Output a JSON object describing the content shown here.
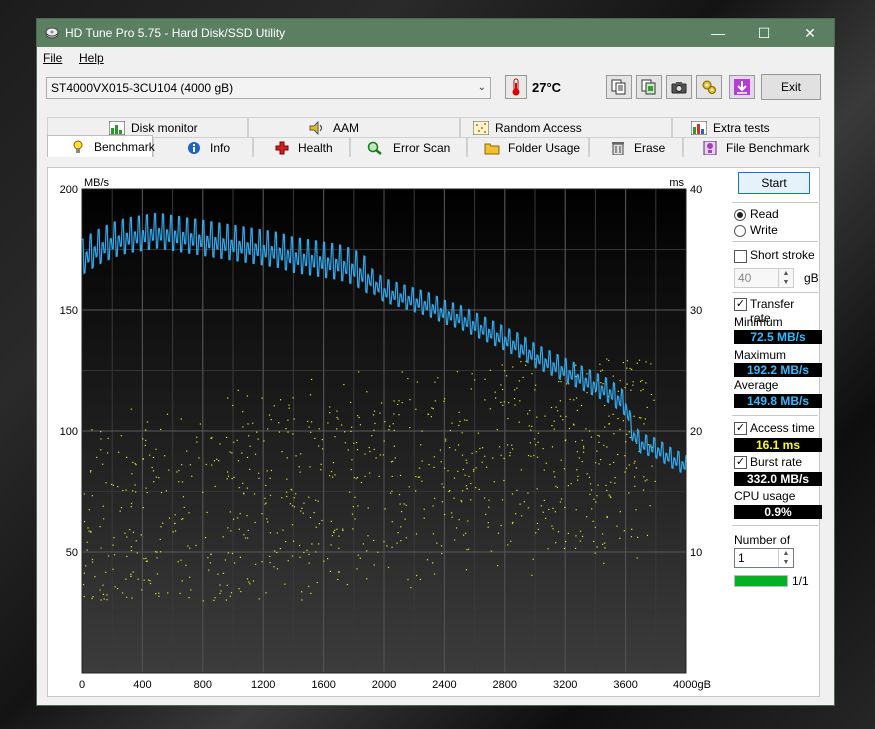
{
  "window": {
    "title": "HD Tune Pro 5.75 - Hard Disk/SSD Utility",
    "controls": {
      "minimize": "—",
      "maximize": "☐",
      "close": "✕"
    }
  },
  "menu": {
    "file": "File",
    "help": "Help"
  },
  "toolbar": {
    "drive": "ST4000VX015-3CU104 (4000 gB)",
    "temperature": "27°C",
    "exit_label": "Exit",
    "icons": [
      "copy-text-icon",
      "copy-screenshot-icon",
      "camera-icon",
      "options-icon",
      "save-down-icon"
    ]
  },
  "tabs_top": [
    {
      "label": "Disk monitor",
      "icon": "disk-monitor-icon"
    },
    {
      "label": "AAM",
      "icon": "speaker-icon"
    },
    {
      "label": "Random Access",
      "icon": "random-access-icon"
    },
    {
      "label": "Extra tests",
      "icon": "extra-tests-icon"
    }
  ],
  "tabs_bottom": [
    {
      "label": "Benchmark",
      "icon": "lightbulb-icon",
      "active": true
    },
    {
      "label": "Info",
      "icon": "info-icon"
    },
    {
      "label": "Health",
      "icon": "health-cross-icon"
    },
    {
      "label": "Error Scan",
      "icon": "magnifier-icon"
    },
    {
      "label": "Folder Usage",
      "icon": "folder-icon"
    },
    {
      "label": "Erase",
      "icon": "trash-icon"
    },
    {
      "label": "File Benchmark",
      "icon": "file-benchmark-icon"
    }
  ],
  "side": {
    "start_label": "Start",
    "read_label": "Read",
    "write_label": "Write",
    "mode_selected": "Read",
    "short_stroke_label": "Short stroke",
    "short_stroke_checked": false,
    "short_stroke_value": "40",
    "short_stroke_unit": "gB",
    "transfer_rate_label": "Transfer rate",
    "transfer_rate_checked": true,
    "minimum_label": "Minimum",
    "minimum_value": "72.5 MB/s",
    "maximum_label": "Maximum",
    "maximum_value": "192.2 MB/s",
    "average_label": "Average",
    "average_value": "149.8 MB/s",
    "access_time_label": "Access time",
    "access_time_checked": true,
    "access_time_value": "16.1 ms",
    "burst_rate_label": "Burst rate",
    "burst_rate_checked": true,
    "burst_rate_value": "332.0 MB/s",
    "cpu_usage_label": "CPU usage",
    "cpu_usage_value": "0.9%",
    "passes_label": "Number of passes",
    "passes_value": "1",
    "progress_fraction": 1.0,
    "progress_text": "1/1"
  },
  "colors": {
    "titlebar": "#5a7f61",
    "transfer_line": "#33aaee",
    "access_dots": "#e6e62a",
    "value_cyan": "#33bbff",
    "value_yellow": "#ffff00",
    "value_white": "#ffffff"
  },
  "chart_data": {
    "type": "line",
    "ylabel": "MB/s",
    "y2label": "ms",
    "xunit": "gB",
    "xlim": [
      0,
      4000
    ],
    "ylim": [
      0,
      200
    ],
    "y2lim": [
      0,
      40
    ],
    "x_ticks": [
      "0",
      "400",
      "800",
      "1200",
      "1600",
      "2000",
      "2400",
      "2800",
      "3200",
      "3600",
      "4000gB"
    ],
    "y_ticks": [
      "50",
      "100",
      "150",
      "200"
    ],
    "y2_ticks": [
      "10",
      "20",
      "30",
      "40"
    ],
    "grid": true,
    "series": [
      {
        "kind": "transfer-rate-line",
        "x": [
          0,
          100,
          200,
          300,
          400,
          500,
          600,
          700,
          800,
          900,
          1000,
          1100,
          1200,
          1300,
          1400,
          1500,
          1600,
          1700,
          1800,
          1900,
          2000,
          2100,
          2200,
          2300,
          2400,
          2500,
          2600,
          2700,
          2800,
          2900,
          3000,
          3100,
          3200,
          3300,
          3400,
          3500,
          3600,
          3650,
          3700,
          3800,
          3900,
          4000
        ],
        "y": [
          170,
          174,
          177,
          179,
          180,
          181,
          180,
          179,
          178,
          177,
          176,
          175,
          174,
          173,
          171,
          170,
          169,
          168,
          166,
          162,
          157,
          155,
          153,
          151,
          148,
          146,
          143,
          140,
          137,
          134,
          130,
          127,
          124,
          121,
          118,
          115,
          110,
          98,
          94,
          92,
          88,
          85
        ]
      },
      {
        "kind": "access-time-scatter",
        "x_range": [
          0,
          3800
        ],
        "y_range_ms": [
          6,
          26
        ]
      }
    ]
  }
}
